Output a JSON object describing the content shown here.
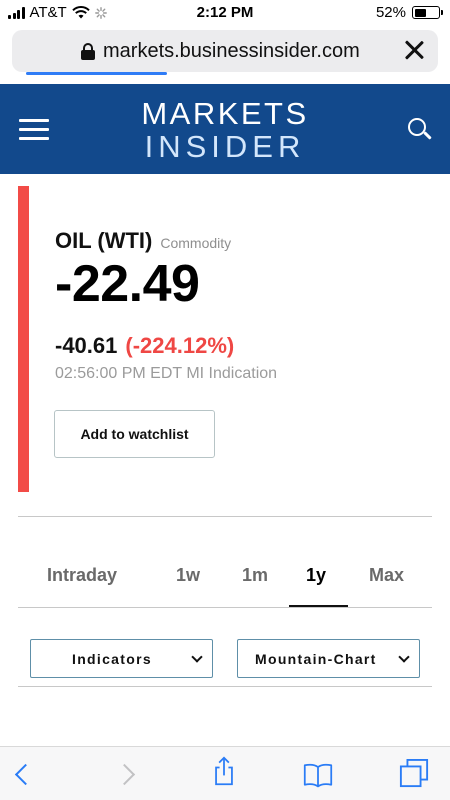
{
  "status_bar": {
    "carrier": "AT&T",
    "time": "2:12 PM",
    "battery": "52%",
    "battery_level": 0.52
  },
  "browser": {
    "url": "markets.businessinsider.com",
    "load_progress": 0.33
  },
  "header": {
    "logo_line1": "MARKETS",
    "logo_line2": "INSIDER"
  },
  "quote": {
    "name": "OIL (WTI)",
    "type": "Commodity",
    "price": "-22.49",
    "change_abs": "-40.61",
    "change_pct": "(-224.12%)",
    "timestamp": "02:56:00 PM EDT MI Indication",
    "watchlist_label": "Add to watchlist",
    "accent_color": "#f24b47",
    "negative_color": "#ef4744"
  },
  "tabs": [
    {
      "label": "Intraday",
      "active": false
    },
    {
      "label": "1w",
      "active": false
    },
    {
      "label": "1m",
      "active": false
    },
    {
      "label": "1y",
      "active": true
    },
    {
      "label": "Max",
      "active": false
    }
  ],
  "dropdowns": {
    "indicators": "Indicators",
    "chart_type": "Mountain-Chart"
  },
  "colors": {
    "header_bg": "#12498c",
    "link_blue": "#2a7cf6"
  },
  "icons": {
    "lock": "lock-icon",
    "close": "close-icon",
    "menu": "hamburger-icon",
    "search": "search-icon",
    "back": "back-arrow-icon",
    "forward": "forward-arrow-icon",
    "share": "share-icon",
    "bookmarks": "bookmarks-icon",
    "tabs": "tabs-icon"
  }
}
